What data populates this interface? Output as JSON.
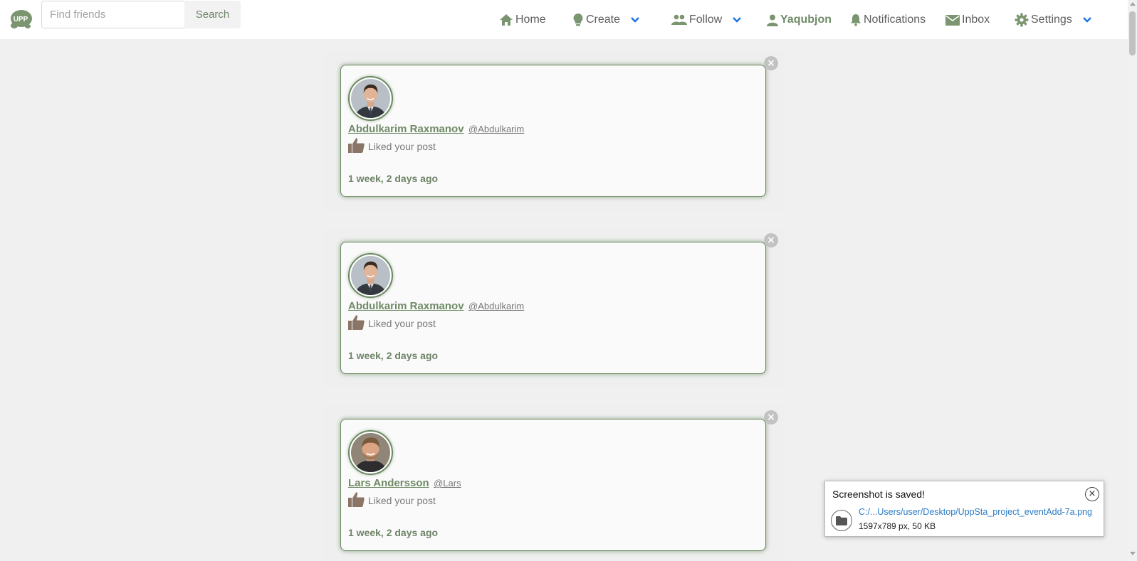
{
  "nav": {
    "logo_text": "UPP",
    "search_placeholder": "Find friends",
    "search_button": "Search",
    "items": [
      {
        "label": "Home",
        "icon": "home-icon"
      },
      {
        "label": "Create",
        "icon": "lightbulb-icon"
      },
      {
        "label": "Follow",
        "icon": "people-icon"
      },
      {
        "label": "Yaqubjon",
        "icon": "person-icon"
      },
      {
        "label": "Notifications",
        "icon": "bell-icon"
      },
      {
        "label": "Inbox",
        "icon": "envelope-icon"
      },
      {
        "label": "Settings",
        "icon": "gear-icon"
      }
    ]
  },
  "notifications": [
    {
      "name": "Abdulkarim Raxmanov",
      "handle": "@Abdulkarim",
      "action": "Liked your post",
      "time": "1 week, 2 days ago",
      "close": "×"
    },
    {
      "name": "Abdulkarim Raxmanov",
      "handle": "@Abdulkarim",
      "action": "Liked your post",
      "time": "1 week, 2 days ago",
      "close": "×"
    },
    {
      "name": "Lars Andersson",
      "handle": "@Lars",
      "action": "Liked your post",
      "time": "1 week, 2 days ago",
      "close": "×"
    }
  ],
  "toast": {
    "title": "Screenshot is saved!",
    "path": "C:/...Users/user/Desktop/UppSta_project_eventAdd-7a.png",
    "meta": "1597x789 px, 50 KB",
    "close": "×"
  },
  "colors": {
    "brand_green": "#6f8a66",
    "card_border": "#6c8a62",
    "chevron_blue": "#1a73e8",
    "thumb_icon": "#8a7567",
    "link_blue": "#2b7bc6"
  }
}
